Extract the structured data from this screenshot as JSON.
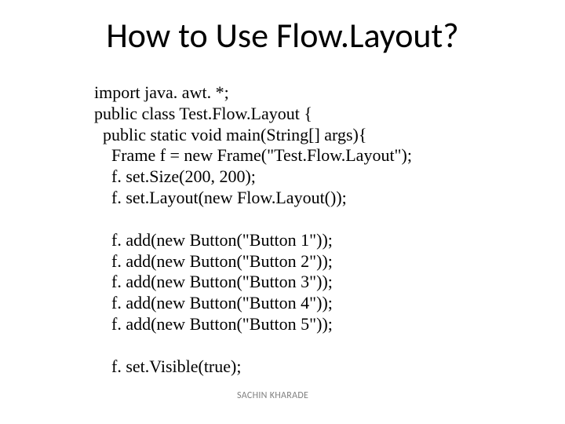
{
  "title": "How to Use Flow.Layout?",
  "code": {
    "l01": "import java. awt. *;",
    "l02": "public class Test.Flow.Layout {",
    "l03": "  public static void main(String[] args){",
    "l04": "    Frame f = new Frame(\"Test.Flow.Layout\");",
    "l05": "    f. set.Size(200, 200);",
    "l06": "    f. set.Layout(new Flow.Layout());",
    "l07": "",
    "l08": "    f. add(new Button(\"Button 1\"));",
    "l09": "    f. add(new Button(\"Button 2\"));",
    "l10": "    f. add(new Button(\"Button 3\"));",
    "l11": "    f. add(new Button(\"Button 4\"));",
    "l12": "    f. add(new Button(\"Button 5\"));",
    "l13": "",
    "l14": "    f. set.Visible(true);"
  },
  "attribution": "SACHIN KHARADE"
}
